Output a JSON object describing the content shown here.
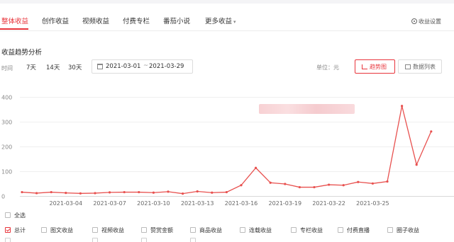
{
  "tabs": [
    {
      "label": "整体收益",
      "active": true
    },
    {
      "label": "创作收益",
      "active": false
    },
    {
      "label": "视频收益",
      "active": false
    },
    {
      "label": "付费专栏",
      "active": false
    },
    {
      "label": "番茄小说",
      "active": false
    },
    {
      "label": "更多收益",
      "active": false
    }
  ],
  "settings_label": "收益设置",
  "section_title": "收益趋势分析",
  "time_label": "时间",
  "ranges": [
    "7天",
    "14天",
    "30天"
  ],
  "date_range": {
    "start": "2021-03-01",
    "separator": "~",
    "end": "2021-03-29"
  },
  "unit_label": "单位：元",
  "view_buttons": [
    {
      "label": "趋势图",
      "icon": "line-chart-icon",
      "active": true
    },
    {
      "label": "数据列表",
      "icon": "list-icon",
      "active": false
    }
  ],
  "accent_color": "#e8343b",
  "chart_data": {
    "type": "line",
    "x": [
      "2021-03-01",
      "2021-03-02",
      "2021-03-03",
      "2021-03-04",
      "2021-03-05",
      "2021-03-06",
      "2021-03-07",
      "2021-03-08",
      "2021-03-09",
      "2021-03-10",
      "2021-03-11",
      "2021-03-12",
      "2021-03-13",
      "2021-03-14",
      "2021-03-15",
      "2021-03-16",
      "2021-03-17",
      "2021-03-18",
      "2021-03-19",
      "2021-03-20",
      "2021-03-21",
      "2021-03-22",
      "2021-03-23",
      "2021-03-24",
      "2021-03-25",
      "2021-03-26",
      "2021-03-27",
      "2021-03-28",
      "2021-03-29"
    ],
    "x_tick_labels": [
      "2021-03-04",
      "2021-03-07",
      "2021-03-10",
      "2021-03-13",
      "2021-03-16",
      "2021-03-19",
      "2021-03-22",
      "2021-03-25"
    ],
    "series": [
      {
        "values": [
          17,
          13,
          17,
          14,
          12,
          13,
          16,
          17,
          17,
          15,
          19,
          11,
          20,
          15,
          17,
          45,
          115,
          55,
          50,
          37,
          37,
          47,
          45,
          58,
          52,
          60,
          365,
          128,
          262
        ],
        "color": "#e8514f"
      }
    ],
    "yticks": [
      0,
      100,
      200,
      300,
      400
    ],
    "ylim": [
      0,
      400
    ],
    "grid": true
  },
  "checkbox_rows": [
    [
      {
        "label": "全选",
        "checked": false
      }
    ],
    [
      {
        "label": "总计",
        "checked": true
      },
      {
        "label": "图文收益",
        "checked": false
      },
      {
        "label": "视频收益",
        "checked": false
      },
      {
        "label": "赞赏金额",
        "checked": false
      },
      {
        "label": "商品收益",
        "checked": false
      },
      {
        "label": "连载收益",
        "checked": false
      },
      {
        "label": "专栏收益",
        "checked": false
      },
      {
        "label": "付费直播",
        "checked": false
      },
      {
        "label": "圈子收益",
        "checked": false
      }
    ]
  ]
}
